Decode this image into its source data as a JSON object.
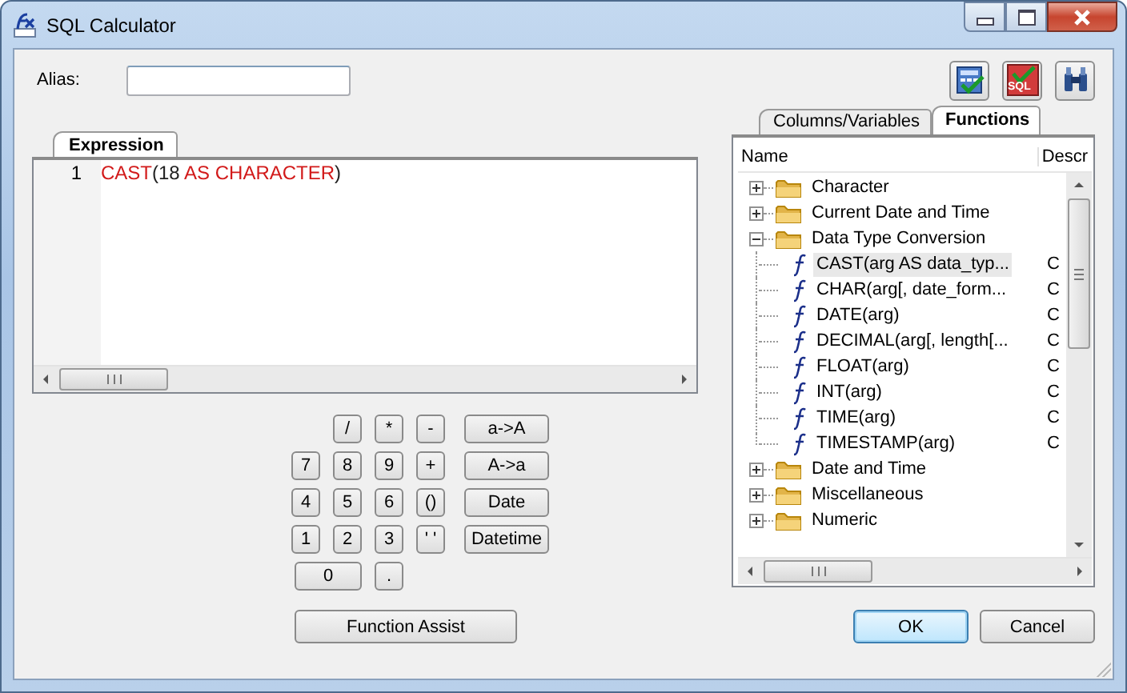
{
  "window": {
    "title": "SQL Calculator"
  },
  "alias": {
    "label": "Alias:"
  },
  "toolbar": [
    {
      "kind": "calculator"
    },
    {
      "kind": "sql",
      "text": "SQL"
    },
    {
      "kind": "binoculars"
    }
  ],
  "expression": {
    "tab": "Expression",
    "lines": [
      {
        "number": "1",
        "tokens": [
          {
            "text": "CAST",
            "kind": "keyword"
          },
          {
            "text": "(18 ",
            "kind": "plain"
          },
          {
            "text": "AS CHARACTER",
            "kind": "keyword"
          },
          {
            "text": ")",
            "kind": "plain"
          }
        ]
      }
    ]
  },
  "keypad": [
    [
      {
        "kind": "gap"
      },
      {
        "label": "/",
        "kind": "key"
      },
      {
        "label": "*",
        "kind": "key"
      },
      {
        "label": "-",
        "kind": "key"
      },
      {
        "label": "a->A",
        "kind": "wide"
      }
    ],
    [
      {
        "label": "7",
        "kind": "key"
      },
      {
        "label": "8",
        "kind": "key"
      },
      {
        "label": "9",
        "kind": "key"
      },
      {
        "label": "+",
        "kind": "key"
      },
      {
        "label": "A->a",
        "kind": "wide"
      }
    ],
    [
      {
        "label": "4",
        "kind": "key"
      },
      {
        "label": "5",
        "kind": "key"
      },
      {
        "label": "6",
        "kind": "key"
      },
      {
        "label": "()",
        "kind": "key"
      },
      {
        "label": "Date",
        "kind": "wide"
      }
    ],
    [
      {
        "label": "1",
        "kind": "key"
      },
      {
        "label": "2",
        "kind": "key"
      },
      {
        "label": "3",
        "kind": "key"
      },
      {
        "label": "' '",
        "kind": "key"
      },
      {
        "label": "Datetime",
        "kind": "wide"
      }
    ],
    [
      {
        "label": "0",
        "kind": "double"
      },
      {
        "label": ".",
        "kind": "key"
      }
    ]
  ],
  "function_assist": "Function Assist",
  "browser": {
    "tabs": [
      {
        "label": "Columns/Variables",
        "selected": false
      },
      {
        "label": "Functions",
        "selected": true
      }
    ],
    "columns": [
      "Name",
      "Descr"
    ],
    "tree": [
      {
        "name": "Character",
        "expanded": false
      },
      {
        "name": "Current Date and Time",
        "expanded": false
      },
      {
        "name": "Data Type Conversion",
        "expanded": true,
        "children": [
          {
            "name": "CAST(arg AS data_typ...",
            "description": "C",
            "selected": true
          },
          {
            "name": "CHAR(arg[, date_form...",
            "description": "C",
            "selected": false
          },
          {
            "name": "DATE(arg)",
            "description": "C",
            "selected": false
          },
          {
            "name": "DECIMAL(arg[, length[...",
            "description": "C",
            "selected": false
          },
          {
            "name": "FLOAT(arg)",
            "description": "C",
            "selected": false
          },
          {
            "name": "INT(arg)",
            "description": "C",
            "selected": false
          },
          {
            "name": "TIME(arg)",
            "description": "C",
            "selected": false
          },
          {
            "name": "TIMESTAMP(arg)",
            "description": "C",
            "selected": false
          }
        ]
      },
      {
        "name": "Date and Time",
        "expanded": false
      },
      {
        "name": "Miscellaneous",
        "expanded": false
      },
      {
        "name": "Numeric",
        "expanded": false
      }
    ]
  },
  "buttons": [
    {
      "label": "OK",
      "default": true
    },
    {
      "label": "Cancel",
      "default": false
    }
  ]
}
